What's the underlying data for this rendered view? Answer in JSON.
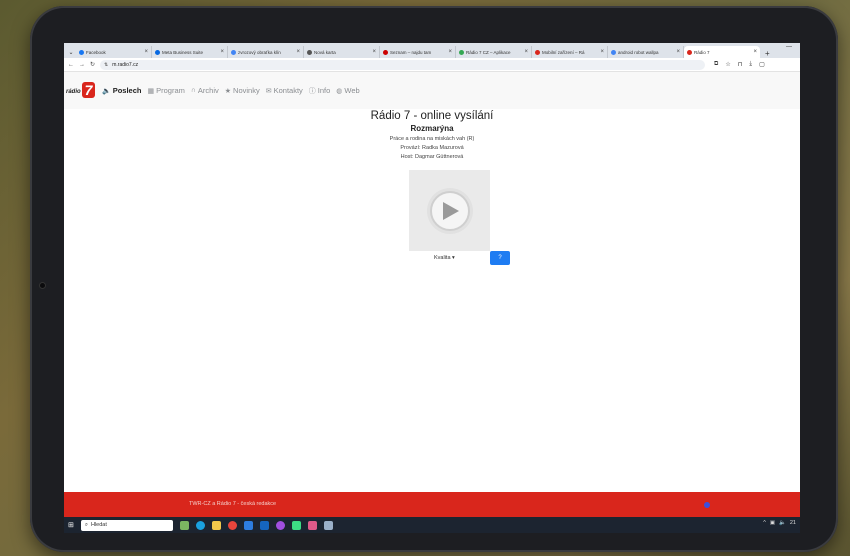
{
  "browser": {
    "tabs": [
      {
        "label": "Facebook",
        "color": "#1877f2"
      },
      {
        "label": "Meta Business Suite",
        "color": "#0668e1"
      },
      {
        "label": "zvrozový obraťka klín",
        "color": "#4285f4"
      },
      {
        "label": "Nová karta",
        "color": "#555555"
      },
      {
        "label": "Seznam – najdu tam",
        "color": "#cc0000"
      },
      {
        "label": "Rádio 7 CZ – Aplikace",
        "color": "#34a853"
      },
      {
        "label": "Mobilní zařízení – Rá",
        "color": "#d9261c"
      },
      {
        "label": "android robot wallpa",
        "color": "#4285f4"
      },
      {
        "label": "Rádio 7",
        "color": "#d9261c"
      }
    ],
    "url": "m.radio7.cz"
  },
  "site": {
    "logo_text": "rádio",
    "logo_number": "7",
    "nav": [
      {
        "icon": "speaker-icon",
        "glyph": "🔊",
        "label": "Poslech"
      },
      {
        "icon": "calendar-icon",
        "glyph": "▦",
        "label": "Program"
      },
      {
        "icon": "headphones-icon",
        "glyph": "🎧",
        "label": "Archiv"
      },
      {
        "icon": "star-icon",
        "glyph": "★",
        "label": "Novinky"
      },
      {
        "icon": "envelope-icon",
        "glyph": "✉",
        "label": "Kontakty"
      },
      {
        "icon": "info-icon",
        "glyph": "ⓘ",
        "label": "Info"
      },
      {
        "icon": "globe-icon",
        "glyph": "◍",
        "label": "Web"
      }
    ]
  },
  "main": {
    "title": "Rádio 7 - online vysílání",
    "show": "Rozmarýna",
    "subtitle": "Práce a rodina na miskách vah (R)",
    "host1": "Provází: Radka Mazurová",
    "host2": "Host: Dagmar Güttnerová",
    "quality_label": "Kvalita",
    "quality_button": "?"
  },
  "footer": {
    "text": "TWR-CZ a Rádio 7 - česká redakce"
  },
  "taskbar": {
    "search_placeholder": "Hledat",
    "tray_time": "21"
  },
  "colors": {
    "brand_red": "#d9261c",
    "button_blue": "#1e7cf2"
  }
}
